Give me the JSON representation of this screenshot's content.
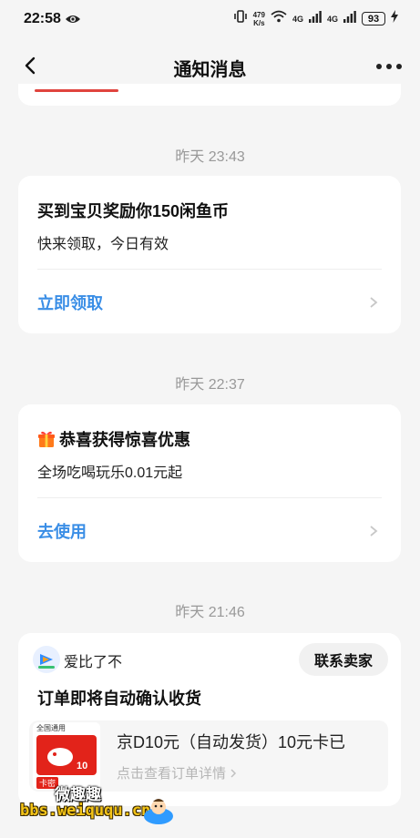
{
  "status_bar": {
    "time": "22:58",
    "net_speed_value": "479",
    "net_speed_unit": "K/s",
    "network_1": "4G",
    "network_2": "4G",
    "battery": "93"
  },
  "nav": {
    "title": "通知消息"
  },
  "messages": [
    {
      "timestamp": "昨天 23:43",
      "heading": "买到宝贝奖励你150闲鱼币",
      "subtitle": "快来领取，今日有效",
      "action": "立即领取"
    },
    {
      "timestamp": "昨天 22:37",
      "heading": "恭喜获得惊喜优惠",
      "subtitle": "全场吃喝玩乐0.01元起",
      "action": "去使用"
    }
  ],
  "order_message": {
    "timestamp": "昨天 21:46",
    "seller_name": "爱比了不",
    "contact_button": "联系卖家",
    "heading": "订单即将自动确认收货",
    "product_name": "京D10元（自动发货）10元卡已",
    "product_link": "点击查看订单详情",
    "thumbnail_card_value": "10",
    "thumbnail_header": "全国通用",
    "thumbnail_tag": "卡密"
  },
  "watermark": {
    "text_cn": "微趣趣",
    "url": "bbs.weiququ.cn"
  },
  "colors": {
    "accent_blue": "#3a8ee6",
    "background": "#f5f5f5",
    "card": "#ffffff",
    "timestamp_gray": "#999999"
  }
}
